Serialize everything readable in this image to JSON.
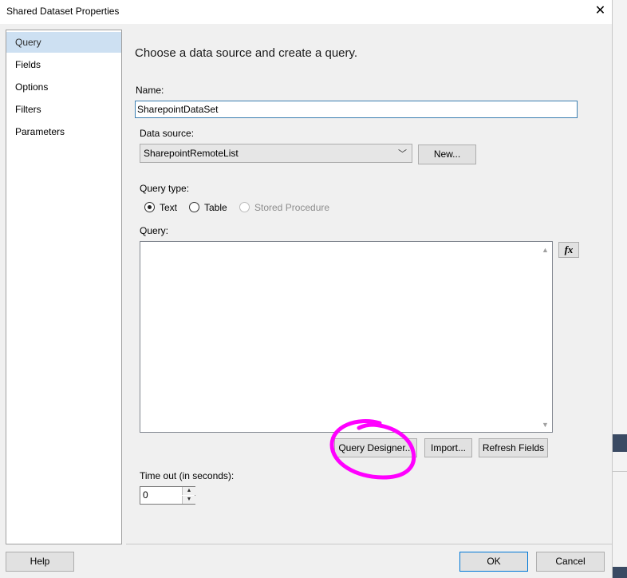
{
  "window": {
    "title": "Shared Dataset Properties",
    "close_glyph": "✕"
  },
  "nav": {
    "items": [
      {
        "label": "Query",
        "selected": true
      },
      {
        "label": "Fields"
      },
      {
        "label": "Options"
      },
      {
        "label": "Filters"
      },
      {
        "label": "Parameters"
      }
    ]
  },
  "main": {
    "heading": "Choose a data source and create a query.",
    "name_label": "Name:",
    "name_value": "SharepointDataSet",
    "datasource_label": "Data source:",
    "datasource_value": "SharepointRemoteList",
    "new_button": "New...",
    "querytype_label": "Query type:",
    "querytype_options": [
      {
        "label": "Text",
        "checked": true
      },
      {
        "label": "Table"
      },
      {
        "label": "Stored Procedure",
        "disabled": true
      }
    ],
    "query_label": "Query:",
    "query_text": "",
    "fx_label": "fx",
    "query_designer_button": "Query Designer...",
    "import_button": "Import...",
    "refresh_fields_button": "Refresh Fields",
    "timeout_label": "Time out (in seconds):",
    "timeout_value": "0"
  },
  "footer": {
    "help": "Help",
    "ok": "OK",
    "cancel": "Cancel"
  },
  "colors": {
    "selection": "#cde0f2",
    "annotation": "#ff00ff"
  }
}
